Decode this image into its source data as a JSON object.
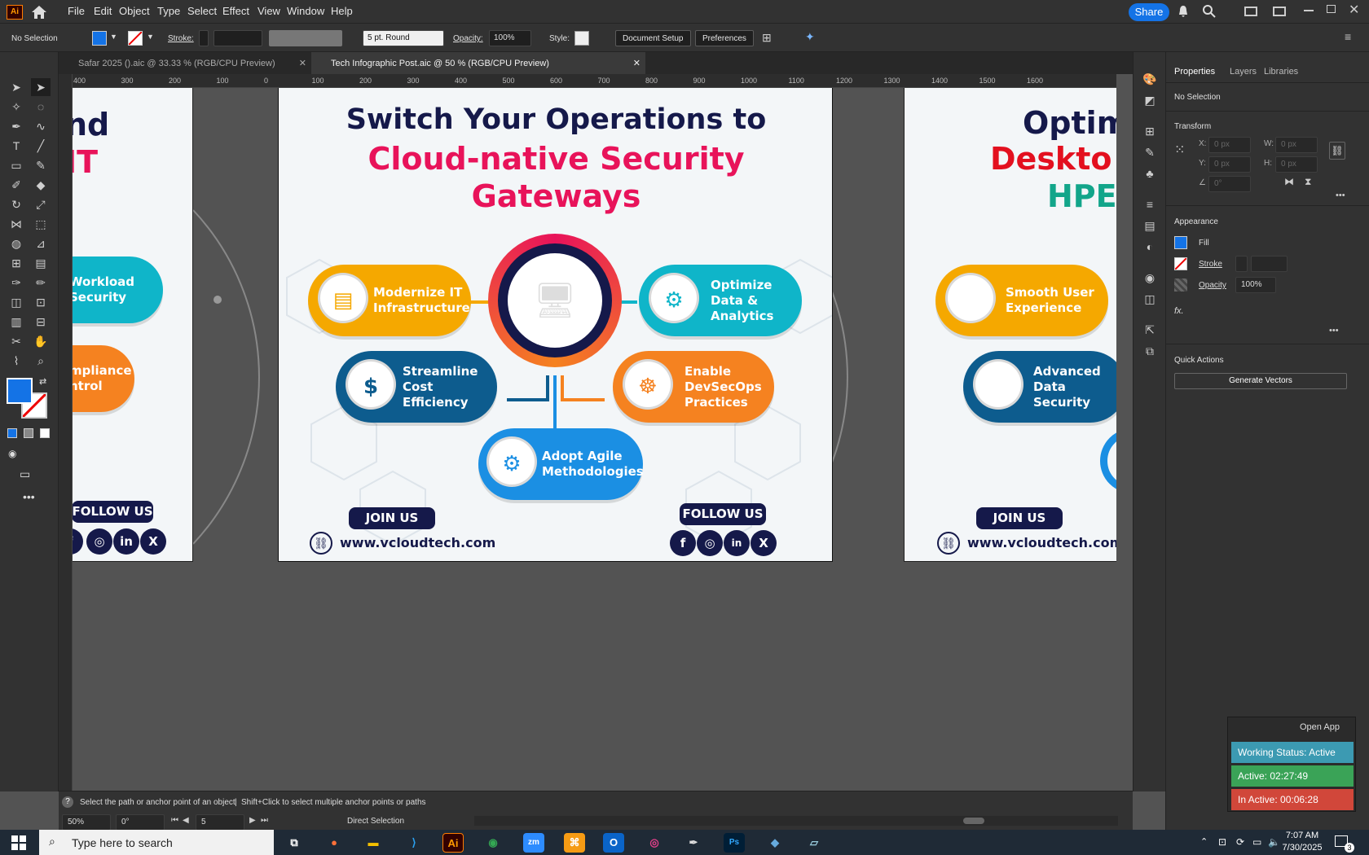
{
  "menubar": {
    "app_badge": "Ai",
    "items": [
      "File",
      "Edit",
      "Object",
      "Type",
      "Select",
      "Effect",
      "View",
      "Window",
      "Help"
    ],
    "share_label": "Share"
  },
  "controlbar": {
    "selection": "No Selection",
    "stroke_label": "Stroke:",
    "brush_label": "5 pt. Round",
    "opacity_label": "Opacity:",
    "opacity_value": "100%",
    "style_label": "Style:",
    "document_setup": "Document Setup",
    "preferences": "Preferences",
    "fill_color": "#1473e6"
  },
  "tabs": [
    {
      "label": "Safar 2025 ().aic @ 33.33 % (RGB/CPU Preview)"
    },
    {
      "label": "Tech Infographic Post.aic @ 50 % (RGB/CPU Preview)"
    }
  ],
  "ruler": {
    "h_ticks": [
      "400",
      "300",
      "200",
      "100",
      "0",
      "100",
      "200",
      "300",
      "400",
      "500",
      "600",
      "700",
      "800",
      "900",
      "1000",
      "1100",
      "1200",
      "1300",
      "1400",
      "1500",
      "1600"
    ]
  },
  "artboard_main": {
    "title_line1": "Switch Your Operations to",
    "title_line2": "Cloud-native Security",
    "title_line3": "Gateways",
    "items": [
      {
        "label": "Modernize IT Infrastructure",
        "color": "#f5a800"
      },
      {
        "label": "Optimize Data & Analytics",
        "color": "#0fb5c9"
      },
      {
        "label": "Streamline Cost Efficiency",
        "color": "#0d5c8e"
      },
      {
        "label": "Enable DevSecOps Practices",
        "color": "#f58220"
      },
      {
        "label": "Adopt Agile Methodologies",
        "color": "#1b8fe3"
      }
    ],
    "join_label": "JOIN US",
    "follow_label": "FOLLOW US",
    "website": "www.vcloudtech.com",
    "social": [
      "f",
      "◎",
      "in",
      "X"
    ],
    "title_color": "#15194a",
    "accent_color": "#e8135a"
  },
  "artboard_left": {
    "title_frag1": "nd",
    "title_frag2": "IT",
    "items": [
      {
        "label": "Workload Security",
        "color": "#0fb5c9"
      },
      {
        "label": "mpliance ntrol",
        "color": "#f58220"
      }
    ],
    "follow_label": "FOLLOW US"
  },
  "artboard_right": {
    "title_frag1": "Optim",
    "title_frag2": "Deskto",
    "title_frag3": "HPE",
    "items": [
      {
        "label": "Smooth User Experience",
        "color": "#f5a800"
      },
      {
        "label": "Advanced Data Security",
        "color": "#0d5c8e"
      }
    ],
    "join_label": "JOIN US",
    "website": "www.vcloudtech.com"
  },
  "properties": {
    "tabs": [
      "Properties",
      "Layers",
      "Libraries"
    ],
    "selection": "No Selection",
    "transform": "Transform",
    "x_label": "X:",
    "y_label": "Y:",
    "w_label": "W:",
    "h_label": "H:",
    "x_value": "0 px",
    "y_value": "0 px",
    "w_value": "0 px",
    "h_value": "0 px",
    "angle_value": "0°",
    "appearance": "Appearance",
    "fill_label": "Fill",
    "stroke_label": "Stroke",
    "opacity_label": "Opacity",
    "opacity_value": "100%",
    "fx_label": "fx.",
    "quick_actions": "Quick Actions",
    "generate_vectors": "Generate Vectors"
  },
  "statusbar": {
    "hint": "Select the path or anchor point of an object",
    "hint2": "Shift+Click to select multiple anchor points or paths",
    "zoom": "50%",
    "rotate": "0°",
    "artboard_num": "5",
    "tool": "Direct Selection"
  },
  "widget": {
    "open_app": "Open App",
    "working_status": "Working Status: Active",
    "active": "Active: 02:27:49",
    "inactive": "In Active: 00:06:28"
  },
  "taskbar": {
    "search_placeholder": "Type here to search",
    "time": "7:07 AM",
    "date": "7/30/2025",
    "notif_count": "3"
  }
}
